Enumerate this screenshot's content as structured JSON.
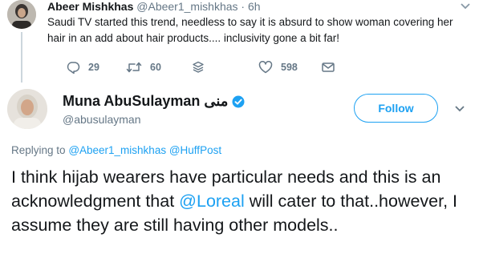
{
  "parent_tweet": {
    "display_name": "Abeer Mishkhas",
    "handle": "@Abeer1_mishkhas",
    "separator": " · ",
    "time": "6h",
    "text": "Saudi TV started this trend, needless to say it is absurd to show woman covering her hair in an add about hair products.... inclusivity gone a bit far!",
    "reply_count": "29",
    "retweet_count": "60",
    "like_count": "598",
    "icons": [
      "reply-icon",
      "retweet-icon",
      "stack-icon",
      "heart-icon",
      "envelope-icon",
      "chevron-down-icon"
    ]
  },
  "main_tweet": {
    "display_name": "Muna AbuSulayman منى",
    "handle": "@abusulayman",
    "follow_label": "Follow",
    "replying_prefix": "Replying to",
    "replying_to_1": "@Abeer1_mishkhas",
    "replying_to_2": "@HuffPost",
    "text_before_mention": "I think hijab wearers have particular needs and this is an acknowledgment that ",
    "mention": "@Loreal",
    "text_after_mention": " will cater to that..however, I assume they are still having other models..",
    "icons": [
      "verified-badge-icon",
      "chevron-down-icon"
    ]
  },
  "colors": {
    "accent": "#1da1f2",
    "text_primary": "#14171a",
    "text_secondary": "#657786",
    "divider": "#ccd6dd"
  }
}
